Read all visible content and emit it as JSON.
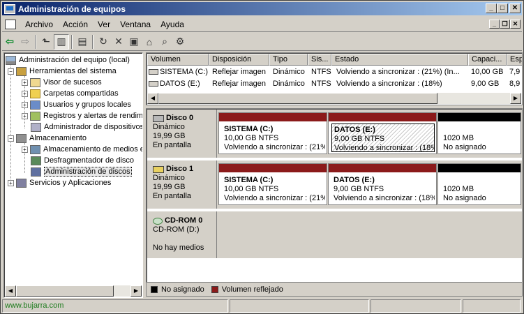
{
  "window": {
    "title": "Administración de equipos"
  },
  "menu": [
    "Archivo",
    "Acción",
    "Ver",
    "Ventana",
    "Ayuda"
  ],
  "tree": {
    "root": "Administración del equipo (local)",
    "items": [
      {
        "label": "Herramientas del sistema",
        "level": 1,
        "icon": "tools-icon"
      },
      {
        "label": "Visor de sucesos",
        "level": 2,
        "icon": "event-viewer-icon"
      },
      {
        "label": "Carpetas compartidas",
        "level": 2,
        "icon": "folder-icon"
      },
      {
        "label": "Usuarios y grupos locales",
        "level": 2,
        "icon": "users-icon"
      },
      {
        "label": "Registros y alertas de rendim",
        "level": 2,
        "icon": "performance-icon"
      },
      {
        "label": "Administrador de dispositivos",
        "level": 2,
        "icon": "device-manager-icon"
      },
      {
        "label": "Almacenamiento",
        "level": 1,
        "icon": "storage-icon"
      },
      {
        "label": "Almacenamiento de medios e",
        "level": 2,
        "icon": "media-icon"
      },
      {
        "label": "Desfragmentador de disco",
        "level": 2,
        "icon": "defrag-icon"
      },
      {
        "label": "Administración de discos",
        "level": 2,
        "icon": "disk-management-icon"
      },
      {
        "label": "Servicios y Aplicaciones",
        "level": 1,
        "icon": "services-icon"
      }
    ]
  },
  "volumes": {
    "columns": [
      "Volumen",
      "Disposición",
      "Tipo",
      "Sis...",
      "Estado",
      "Capaci...",
      "Esp"
    ],
    "rows": [
      [
        "SISTEMA (C:)",
        "Reflejar imagen",
        "Dinámico",
        "NTFS",
        "Volviendo a sincronizar : (21%) (In...",
        "10,00 GB",
        "7,9"
      ],
      [
        "DATOS (E:)",
        "Reflejar imagen",
        "Dinámico",
        "NTFS",
        "Volviendo a sincronizar : (18%)",
        "9,00 GB",
        "8,9"
      ]
    ]
  },
  "disks": [
    {
      "name": "Disco 0",
      "type": "Dinámico",
      "size": "19,99 GB",
      "status": "En pantalla",
      "partitions": [
        {
          "name": "SISTEMA  (C:)",
          "size": "10,00 GB NTFS",
          "status": "Volviendo a sincronizar : (21%"
        },
        {
          "name": "DATOS  (E:)",
          "size": "9,00 GB NTFS",
          "status": "Volviendo a sincronizar : (18%"
        },
        {
          "name": "",
          "size": "1020 MB",
          "status": "No asignado"
        }
      ]
    },
    {
      "name": "Disco 1",
      "type": "Dinámico",
      "size": "19,99 GB",
      "status": "En pantalla",
      "partitions": [
        {
          "name": "SISTEMA  (C:)",
          "size": "10,00 GB NTFS",
          "status": "Volviendo a sincronizar : (21%"
        },
        {
          "name": "DATOS  (E:)",
          "size": "9,00 GB NTFS",
          "status": "Volviendo a sincronizar : (18%"
        },
        {
          "name": "",
          "size": "1020 MB",
          "status": "No asignado"
        }
      ]
    },
    {
      "name": "CD-ROM 0",
      "type": "CD-ROM (D:)",
      "size": "",
      "status": "No hay medios",
      "partitions": []
    }
  ],
  "legend": [
    {
      "label": "No asignado",
      "color": "#000000"
    },
    {
      "label": "Volumen reflejado",
      "color": "#8b1a1a"
    }
  ],
  "status": {
    "text": "www.bujarra.com"
  },
  "colors": {
    "mirrored": "#8b1a1a",
    "unallocated": "#000000",
    "titlebar": "#0a246a"
  }
}
